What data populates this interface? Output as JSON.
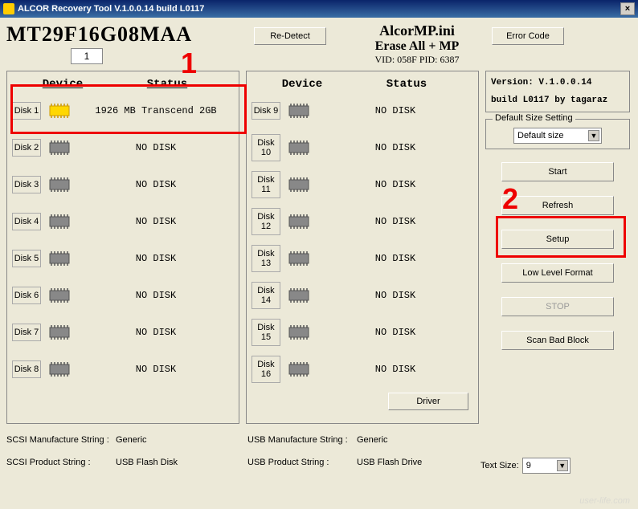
{
  "window": {
    "title": "ALCOR Recovery Tool V.1.0.0.14 build L0117"
  },
  "top": {
    "chipname": "MT29F16G08MAA",
    "numvalue": "1",
    "redetect": "Re-Detect",
    "errorcode": "Error Code",
    "ini": "AlcorMP.ini",
    "mode": "Erase All + MP",
    "vidpid": "VID: 058F    PID: 6387"
  },
  "headers": {
    "device": "Device",
    "status": "Status"
  },
  "disksL": [
    {
      "label": "Disk 1",
      "status": "1926 MB Transcend 2GB",
      "active": true
    },
    {
      "label": "Disk 2",
      "status": "NO DISK",
      "active": false
    },
    {
      "label": "Disk 3",
      "status": "NO DISK",
      "active": false
    },
    {
      "label": "Disk 4",
      "status": "NO DISK",
      "active": false
    },
    {
      "label": "Disk 5",
      "status": "NO DISK",
      "active": false
    },
    {
      "label": "Disk 6",
      "status": "NO DISK",
      "active": false
    },
    {
      "label": "Disk 7",
      "status": "NO DISK",
      "active": false
    },
    {
      "label": "Disk 8",
      "status": "NO DISK",
      "active": false
    }
  ],
  "disksR": [
    {
      "label": "Disk 9",
      "status": "NO DISK"
    },
    {
      "label": "Disk 10",
      "status": "NO DISK"
    },
    {
      "label": "Disk 11",
      "status": "NO DISK"
    },
    {
      "label": "Disk 12",
      "status": "NO DISK"
    },
    {
      "label": "Disk 13",
      "status": "NO DISK"
    },
    {
      "label": "Disk 14",
      "status": "NO DISK"
    },
    {
      "label": "Disk 15",
      "status": "NO DISK"
    },
    {
      "label": "Disk 16",
      "status": "NO DISK"
    }
  ],
  "right": {
    "version": "Version: V.1.0.0.14",
    "build": "build L0117 by tagaraz",
    "sizelegend": "Default Size Setting",
    "sizesel": "Default size",
    "start": "Start",
    "refresh": "Refresh",
    "setup": "Setup",
    "llf": "Low Level Format",
    "stop": "STOP",
    "scan": "Scan Bad Block",
    "driver": "Driver"
  },
  "footer": {
    "scsimfg_l": "SCSI Manufacture String :",
    "scsimfg_v": "Generic",
    "scsiprod_l": "SCSI Product String :",
    "scsiprod_v": "USB Flash Disk",
    "usbmfg_l": "USB Manufacture String :",
    "usbmfg_v": "Generic",
    "usbprod_l": "USB Product String :",
    "usbprod_v": "USB Flash Drive",
    "textsize_l": "Text Size:",
    "textsize_v": "9"
  },
  "annotations": {
    "one": "1",
    "two": "2"
  }
}
